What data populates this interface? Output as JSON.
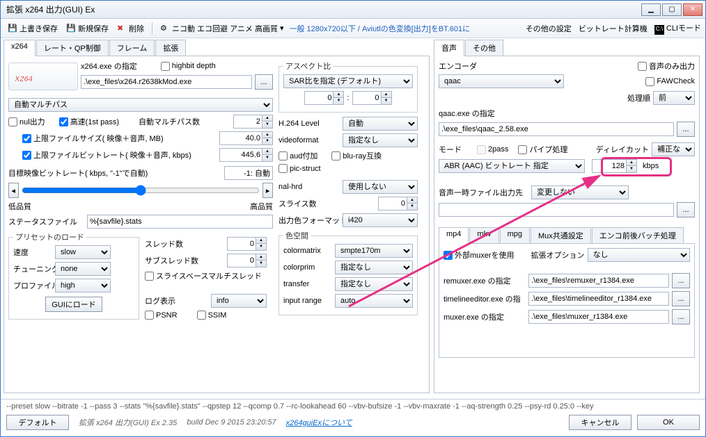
{
  "window": {
    "title": "拡張 x264 出力(GUI) Ex"
  },
  "toolbar": {
    "save": "上書き保存",
    "saveas": "新規保存",
    "delete": "削除",
    "nico": "ニコ動 エコ回避 アニメ 高画質",
    "dropdown_arrow": "▾",
    "spec": "一般 1280x720以下 / Aviutlの色変換[出力]をBT.601に",
    "other": "その他の設定",
    "calc": "ビットレート計算機",
    "cli": "CLIモード"
  },
  "tabs_left": [
    "x264",
    "レート・QP制御",
    "フレーム",
    "拡張"
  ],
  "x264": {
    "exe_label": "x264.exe の指定",
    "highbit": "highbit depth",
    "exe_path": ".\\exe_files\\x264.r2638kMod.exe",
    "multipass": "自動マルチパス",
    "nul": "nul出力",
    "fast1st": "高速(1st pass)",
    "multipass_num_label": "自動マルチパス数",
    "multipass_num": "2",
    "limit_size": "上限ファイルサイズ( 映像＋音声, MB)",
    "limit_size_val": "40.0",
    "limit_rate": "上限ファイルビットレート( 映像＋音声, kbps)",
    "limit_rate_val": "445.6",
    "target_label": "目標映像ビットレート( kbps, \"-1\"で自動)",
    "target_val": "-1: 自動",
    "lowq": "低品質",
    "highq": "高品質",
    "status_label": "ステータスファイル",
    "status_val": "%{savfile}.stats",
    "preset_legend": "プリセットのロード",
    "speed_label": "速度",
    "speed": "slow",
    "tune_label": "チューニング",
    "tune": "none",
    "profile_label": "プロファイル",
    "profile": "high",
    "gui_load": "GUIにロード",
    "threads_label": "スレッド数",
    "threads": "0",
    "subthreads_label": "サブスレッド数",
    "subthreads": "0",
    "slice_mt": "スライスベースマルチスレッド",
    "log_label": "ログ表示",
    "log": "info",
    "psnr": "PSNR",
    "ssim": "SSIM",
    "aspect_legend": "アスペクト比",
    "aspect_mode": "SAR比を指定 (デフォルト)",
    "aspect_a": "0",
    "aspect_b": "0",
    "level_label": "H.264 Level",
    "level": "自動",
    "videofmt_label": "videoformat",
    "videofmt": "指定なし",
    "aud": "aud付加",
    "bluray": "blu-ray互換",
    "pic": "pic-struct",
    "nalhrd_label": "nal-hrd",
    "nalhrd": "使用しない",
    "slices_label": "スライス数",
    "slices": "0",
    "outcolor_label": "出力色フォーマット",
    "outcolor": "i420",
    "cs_legend": "色空間",
    "cmatrix_label": "colormatrix",
    "cmatrix": "smpte170m",
    "cprim_label": "colorprim",
    "cprim": "指定なし",
    "trans_label": "transfer",
    "trans": "指定なし",
    "inrange_label": "input range",
    "inrange": "auto"
  },
  "tabs_right": [
    "音声",
    "その他"
  ],
  "audio": {
    "encoder_label": "エンコーダ",
    "encoder": "qaac",
    "audio_only": "音声のみ出力",
    "faw": "FAWCheck",
    "order_label": "処理順",
    "order": "前",
    "exe_label": "qaac.exe の指定",
    "exe_path": ".\\exe_files\\qaac_2.58.exe",
    "mode_label": "モード",
    "twopass": "2pass",
    "pipe": "パイプ処理",
    "delay_label": "ディレイカット",
    "delay": "補正なし",
    "mode": "ABR (AAC) ビットレート 指定",
    "bitrate": "128",
    "bitrate_unit": "kbps",
    "temp_label": "音声一時ファイル出力先",
    "temp": "変更しない"
  },
  "mux_tabs": [
    "mp4",
    "mkv",
    "mpg",
    "Mux共通設定",
    "エンコ前後バッチ処理"
  ],
  "mux": {
    "ext_mux": "外部muxerを使用",
    "extopt_label": "拡張オプション",
    "extopt": "なし",
    "remuxer_label": "remuxer.exe の指定",
    "remuxer": ".\\exe_files\\remuxer_r1384.exe",
    "tc_label": "timelineeditor.exe の指",
    "tc": ".\\exe_files\\timelineeditor_r1384.exe",
    "muxer_label": "muxer.exe の指定",
    "muxer": ".\\exe_files\\muxer_r1384.exe"
  },
  "footer": {
    "cmd": "--preset slow --bitrate -1 --pass 3 --stats \"%{savfile}.stats\" --qpstep 12 --qcomp 0.7 --rc-lookahead 60 --vbv-bufsize -1 --vbv-maxrate -1 --aq-strength 0.25 --psy-rd 0.25:0 --key",
    "default": "デフォルト",
    "app": "拡張 x264 出力(GUI) Ex 2.35",
    "build": "build Dec  9 2015 23:20:57",
    "link": "x264guiExについて",
    "cancel": "キャンセル",
    "ok": "OK"
  },
  "chart_data": null
}
